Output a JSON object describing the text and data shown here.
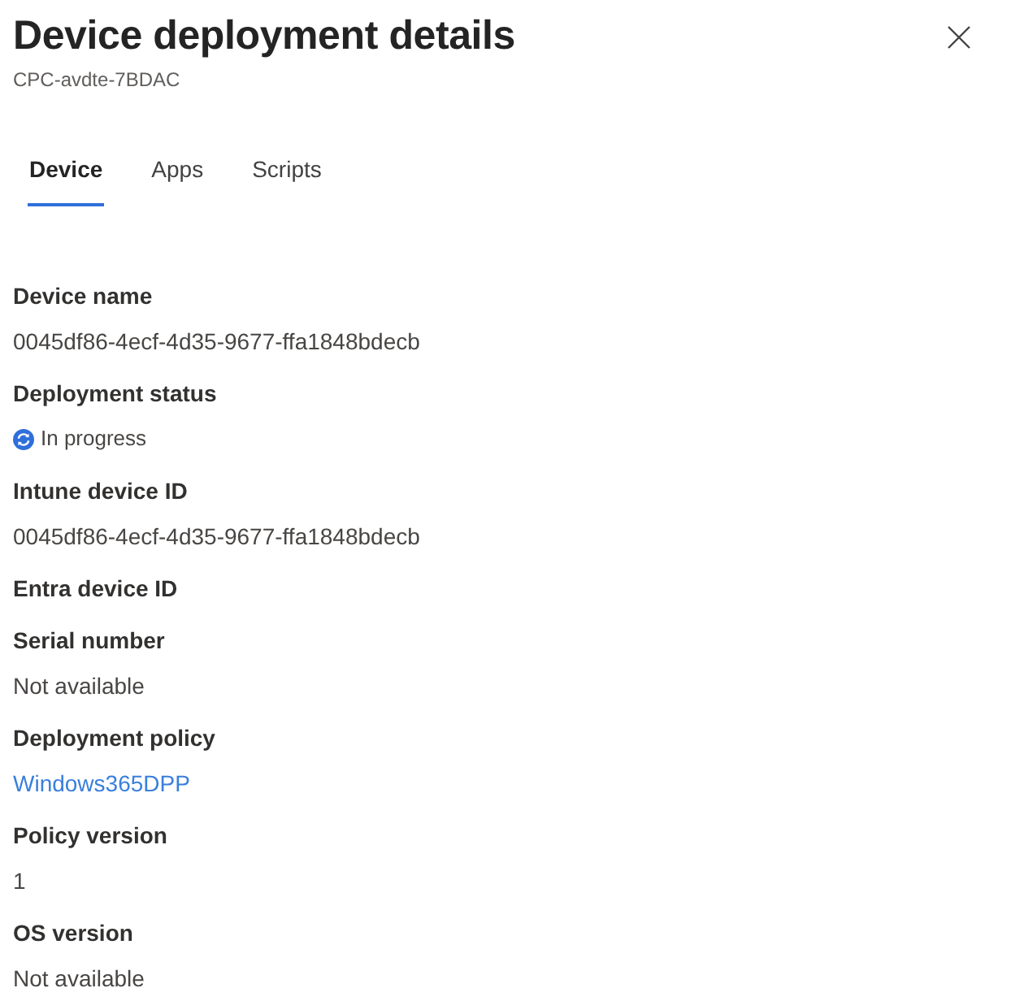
{
  "panel": {
    "title": "Device deployment details",
    "subtitle": "CPC-avdte-7BDAC"
  },
  "tabs": [
    {
      "label": "Device",
      "selected": true
    },
    {
      "label": "Apps",
      "selected": false
    },
    {
      "label": "Scripts",
      "selected": false
    }
  ],
  "fields": [
    {
      "label": "Device name",
      "kind": "text",
      "value": "0045df86-4ecf-4d35-9677-ffa1848bdecb"
    },
    {
      "label": "Deployment status",
      "kind": "status",
      "value": "In progress"
    },
    {
      "label": "Intune device ID",
      "kind": "text",
      "value": "0045df86-4ecf-4d35-9677-ffa1848bdecb"
    },
    {
      "label": "Entra device ID"
    },
    {
      "label": "Serial number",
      "kind": "text",
      "value": "Not available"
    },
    {
      "label": "Deployment policy",
      "kind": "link",
      "value": "Windows365DPP"
    },
    {
      "label": "Policy version",
      "kind": "text",
      "value": "1"
    },
    {
      "label": "OS version",
      "kind": "text",
      "value": "Not available"
    }
  ]
}
